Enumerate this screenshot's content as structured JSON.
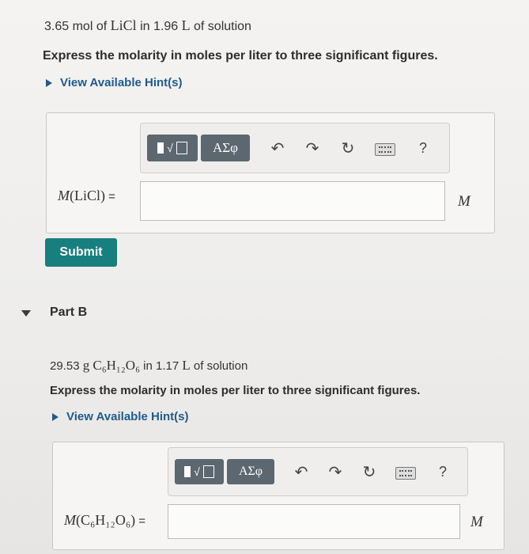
{
  "part_a": {
    "problem_prefix": "3.65 mol of ",
    "problem_compound": "LiCl",
    "problem_mid": " in 1.96 ",
    "problem_unit": "L",
    "problem_suffix": " of solution",
    "instruction": "Express the molarity in moles per liter to three significant figures.",
    "hint_label": "View Available Hint(s)",
    "toolbar": {
      "symbols_label": "ΑΣφ",
      "help_label": "?"
    },
    "answer_label_M": "M",
    "answer_label_compound": "(LiCl)",
    "answer_label_eq": " =",
    "answer_value": "",
    "unit": "M",
    "submit_label": "Submit"
  },
  "part_b": {
    "heading": "Part B",
    "problem_prefix": "29.53 ",
    "problem_g": "g",
    "problem_compound": "C₆H₁₂O₆",
    "problem_mid": " in 1.17 ",
    "problem_unit": "L",
    "problem_suffix": " of solution",
    "instruction": "Express the molarity in moles per liter to three significant figures.",
    "hint_label": "View Available Hint(s)",
    "toolbar": {
      "symbols_label": "ΑΣφ",
      "help_label": "?"
    },
    "answer_label_M": "M",
    "answer_label_compound": "(C₆H₁₂O₆)",
    "answer_label_eq": " =",
    "answer_value": "",
    "unit": "M"
  }
}
